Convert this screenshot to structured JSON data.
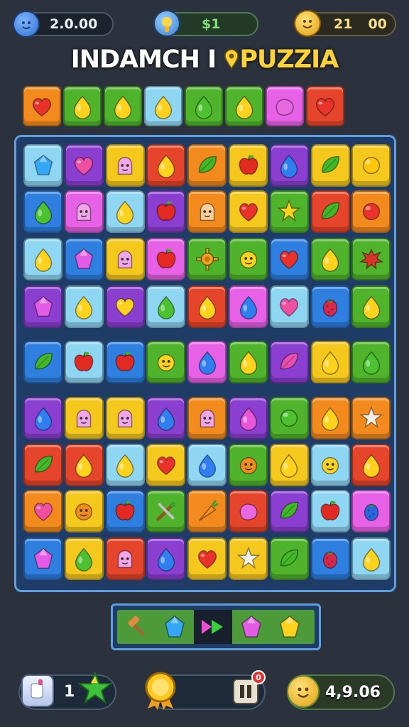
{
  "hud_top": {
    "left_value": "2.0.00",
    "middle_value": "$1",
    "right_value_a": "21",
    "right_value_b": "00"
  },
  "title": {
    "part1": "INDAMCH I ",
    "part2": "PUZZIA"
  },
  "colors": {
    "red": "#e5452a",
    "orange": "#f28a1e",
    "yellow": "#f5c81e",
    "green": "#4fb32c",
    "lightblue": "#8fd6f2",
    "blue": "#2e7fe0",
    "purple": "#8b3fd1",
    "pink": "#e661e6"
  },
  "target_row": [
    {
      "bg": "orange",
      "icon": "heart"
    },
    {
      "bg": "green",
      "icon": "drop-yellow"
    },
    {
      "bg": "green",
      "icon": "drop-yellow"
    },
    {
      "bg": "lightblue",
      "icon": "drop-yellow"
    },
    {
      "bg": "green",
      "icon": "drop-green"
    },
    {
      "bg": "green",
      "icon": "drop-yellow"
    },
    {
      "bg": "pink",
      "icon": "blob-pink"
    },
    {
      "bg": "red",
      "icon": "heart"
    }
  ],
  "board": [
    [
      {
        "bg": "lightblue",
        "icon": "gem-blue"
      },
      {
        "bg": "purple",
        "icon": "heart-pink"
      },
      {
        "bg": "yellow",
        "icon": "face-pink"
      },
      {
        "bg": "red",
        "icon": "drop-yellow"
      },
      {
        "bg": "orange",
        "icon": "leaf-green"
      },
      {
        "bg": "yellow",
        "icon": "apple"
      },
      {
        "bg": "purple",
        "icon": "drop-blue"
      },
      {
        "bg": "yellow",
        "icon": "leaf-green"
      },
      {
        "bg": "yellow",
        "icon": "circle-yellow"
      }
    ],
    [
      {
        "bg": "blue",
        "icon": "drop-green"
      },
      {
        "bg": "pink",
        "icon": "face-pink"
      },
      {
        "bg": "lightblue",
        "icon": "drop-yellow"
      },
      {
        "bg": "purple",
        "icon": "apple"
      },
      {
        "bg": "orange",
        "icon": "face-peach"
      },
      {
        "bg": "yellow",
        "icon": "heart"
      },
      {
        "bg": "green",
        "icon": "star-yellow"
      },
      {
        "bg": "red",
        "icon": "leaf-green"
      },
      {
        "bg": "orange",
        "icon": "circle-red"
      }
    ],
    [
      {
        "bg": "lightblue",
        "icon": "drop-yellow"
      },
      {
        "bg": "blue",
        "icon": "gem-pink"
      },
      {
        "bg": "yellow",
        "icon": "face-pink"
      },
      {
        "bg": "pink",
        "icon": "apple"
      },
      {
        "bg": "green",
        "icon": "gear-orange"
      },
      {
        "bg": "green",
        "icon": "face-yellow"
      },
      {
        "bg": "blue",
        "icon": "heart"
      },
      {
        "bg": "green",
        "icon": "drop-yellow"
      },
      {
        "bg": "green",
        "icon": "splat-red"
      }
    ],
    [
      {
        "bg": "purple",
        "icon": "gem-pink"
      },
      {
        "bg": "lightblue",
        "icon": "drop-yellow"
      },
      {
        "bg": "purple",
        "icon": "heart-yellow"
      },
      {
        "bg": "lightblue",
        "icon": "drop-green"
      },
      {
        "bg": "red",
        "icon": "drop-yellow"
      },
      {
        "bg": "pink",
        "icon": "drop-blue"
      },
      {
        "bg": "lightblue",
        "icon": "heart-pink"
      },
      {
        "bg": "blue",
        "icon": "berry-red"
      },
      {
        "bg": "green",
        "icon": "drop-yellow"
      }
    ],
    [
      {
        "bg": "blue",
        "icon": "leaf-green"
      },
      {
        "bg": "lightblue",
        "icon": "apple"
      },
      {
        "bg": "blue",
        "icon": "apple"
      },
      {
        "bg": "green",
        "icon": "face-yellow"
      },
      {
        "bg": "pink",
        "icon": "drop-blue"
      },
      {
        "bg": "green",
        "icon": "drop-yellow"
      },
      {
        "bg": "purple",
        "icon": "leaf-pink"
      },
      {
        "bg": "yellow",
        "icon": "drop-yellow"
      },
      {
        "bg": "green",
        "icon": "drop-green"
      }
    ],
    [
      {
        "bg": "purple",
        "icon": "drop-blue"
      },
      {
        "bg": "yellow",
        "icon": "face-pink"
      },
      {
        "bg": "yellow",
        "icon": "face-pink"
      },
      {
        "bg": "purple",
        "icon": "drop-blue"
      },
      {
        "bg": "orange",
        "icon": "face-pink"
      },
      {
        "bg": "purple",
        "icon": "drop-pink"
      },
      {
        "bg": "green",
        "icon": "circle-green"
      },
      {
        "bg": "orange",
        "icon": "drop-yellow"
      },
      {
        "bg": "orange",
        "icon": "star-white"
      }
    ],
    [
      {
        "bg": "red",
        "icon": "leaf-green"
      },
      {
        "bg": "red",
        "icon": "drop-yellow"
      },
      {
        "bg": "lightblue",
        "icon": "drop-yellow"
      },
      {
        "bg": "yellow",
        "icon": "heart"
      },
      {
        "bg": "lightblue",
        "icon": "drop-blue"
      },
      {
        "bg": "green",
        "icon": "face-orange"
      },
      {
        "bg": "yellow",
        "icon": "drop-yellow"
      },
      {
        "bg": "lightblue",
        "icon": "face-yellow"
      },
      {
        "bg": "red",
        "icon": "drop-yellow"
      }
    ],
    [
      {
        "bg": "orange",
        "icon": "heart-pink"
      },
      {
        "bg": "yellow",
        "icon": "face-orange"
      },
      {
        "bg": "blue",
        "icon": "apple"
      },
      {
        "bg": "green",
        "icon": "tools"
      },
      {
        "bg": "orange",
        "icon": "carrot"
      },
      {
        "bg": "red",
        "icon": "blob-pink"
      },
      {
        "bg": "purple",
        "icon": "leaf-green"
      },
      {
        "bg": "lightblue",
        "icon": "apple"
      },
      {
        "bg": "pink",
        "icon": "berry-blue"
      }
    ],
    [
      {
        "bg": "blue",
        "icon": "gem-pink"
      },
      {
        "bg": "yellow",
        "icon": "drop-green"
      },
      {
        "bg": "red",
        "icon": "face-pink"
      },
      {
        "bg": "purple",
        "icon": "drop-blue"
      },
      {
        "bg": "yellow",
        "icon": "heart"
      },
      {
        "bg": "yellow",
        "icon": "star-white"
      },
      {
        "bg": "green",
        "icon": "leaf-green"
      },
      {
        "bg": "blue",
        "icon": "berry-red"
      },
      {
        "bg": "lightblue",
        "icon": "drop-yellow"
      }
    ]
  ],
  "boosters": [
    "hammer",
    "gem-blue",
    "arrows-pink-green",
    "gem-pink",
    "gem-yellow"
  ],
  "footer": {
    "left_count": "1",
    "notification_badge": "0",
    "right_value": "4,9.06"
  }
}
